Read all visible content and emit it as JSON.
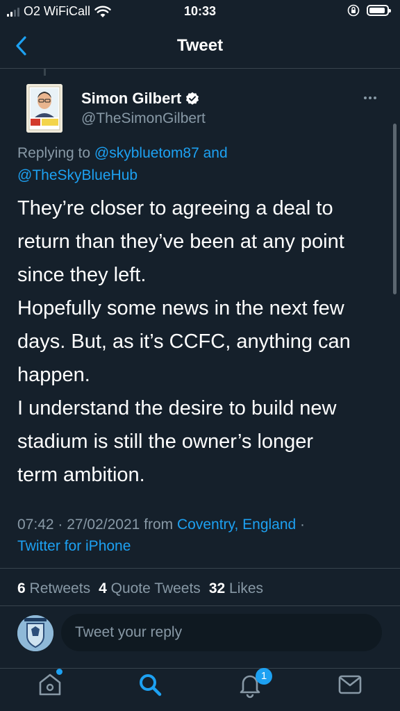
{
  "status_bar": {
    "carrier": "O2 WiFiCall",
    "time": "10:33"
  },
  "nav": {
    "title": "Tweet",
    "back_icon": "chevron-left-icon"
  },
  "tweet": {
    "author_name": "Simon Gilbert",
    "author_handle": "@TheSimonGilbert",
    "verified": true,
    "replying_prefix": "Replying to",
    "replying_to_1": "@skybluetom87 and",
    "replying_to_2": "@TheSkyBlueHub",
    "text_lines": [
      "They’re closer to agreeing a deal to",
      "return than they’ve been at any point",
      "since they left.",
      "Hopefully some news in the next few",
      "days. But, as it’s CCFC, anything can",
      "happen.",
      "I understand the desire to build new",
      "stadium is still the owner’s longer",
      "term ambition."
    ],
    "time": "07:42 · 27/02/2021 from",
    "location": "Coventry, England",
    "separator": " ·",
    "source": "Twitter for iPhone"
  },
  "stats": {
    "retweets_count": "6",
    "retweets_label": "Retweets",
    "quotes_count": "4",
    "quotes_label": "Quote Tweets",
    "likes_count": "32",
    "likes_label": "Likes"
  },
  "reply": {
    "placeholder": "Tweet your reply"
  },
  "tab_bar": {
    "notifications_badge": "1",
    "items": [
      "home-icon",
      "search-icon",
      "notifications-icon",
      "messages-icon"
    ]
  },
  "colors": {
    "background": "#15202b",
    "accent": "#1da1f2",
    "secondary_text": "#8899a6",
    "divider": "#38444d"
  }
}
